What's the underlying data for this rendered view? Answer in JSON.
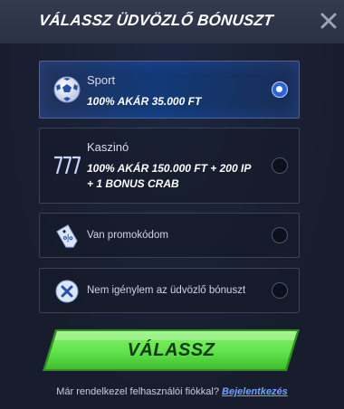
{
  "modal": {
    "title": "VÁLASSZ ÜDVÖZLŐ BÓNUSZT",
    "close_icon": "close-icon"
  },
  "options": [
    {
      "label": "Sport",
      "subtitle": "100% AKÁR 35.000 FT",
      "icon": "soccer-ball-icon",
      "selected": true
    },
    {
      "label": "Kaszinó",
      "subtitle_line1": "100% AKÁR 150.000 FT + 200 IP",
      "subtitle_line2": "+ 1 BONUS CRAB",
      "icon": "slot-777-icon",
      "selected": false
    },
    {
      "label": "Van promokódom",
      "icon": "promo-tag-icon",
      "selected": false
    },
    {
      "label": "Nem igénylem az üdvözlő bónuszt",
      "icon": "decline-x-icon",
      "selected": false
    }
  ],
  "cta": {
    "label": "VÁLASSZ",
    "color": "#5fe34b"
  },
  "footer": {
    "text": "Már rendelkezel felhasználói fiókkal?",
    "link": "Bejelentkezés"
  },
  "colors": {
    "background": "#1b2134",
    "header": "#2f3549",
    "selected_option": "#123a78",
    "accent_blue": "#2e63d8",
    "link": "#6aa7ff"
  }
}
